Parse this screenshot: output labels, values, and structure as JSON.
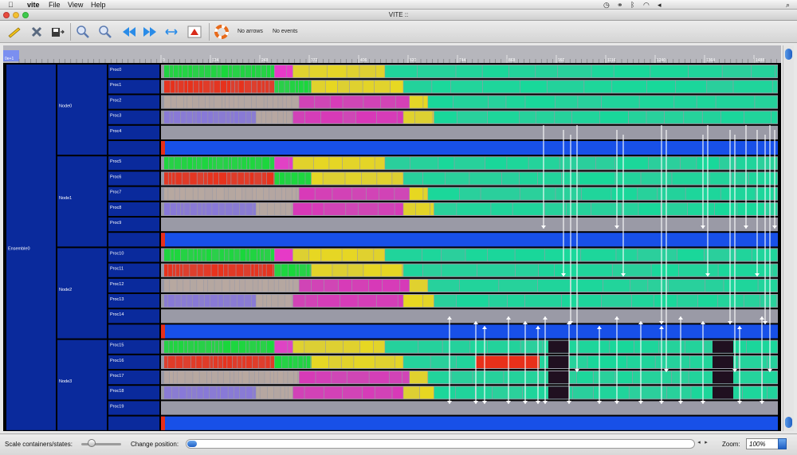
{
  "menubar": {
    "apple": "",
    "app_name": "vite",
    "items": [
      "File",
      "View",
      "Help"
    ]
  },
  "window": {
    "title": "VITE ::"
  },
  "toolbar": {
    "no_arrows_label": "No arrows",
    "no_events_label": "No events"
  },
  "ruler": {
    "start_label": "0e+1",
    "ticks": [
      "0",
      "124",
      "248",
      "372",
      "496",
      "620",
      "744",
      "868",
      "992",
      "1116",
      "1240",
      "1364",
      "1488",
      "1613",
      "1737",
      "1861"
    ]
  },
  "containers": {
    "root": "Ensemble0",
    "nodes": [
      {
        "name": "Node0",
        "procs": [
          "Proc0",
          "Proc1",
          "Proc2",
          "Proc3",
          "Proc4"
        ]
      },
      {
        "name": "Node1",
        "procs": [
          "Proc5",
          "Proc6",
          "Proc7",
          "Proc8",
          "Proc9"
        ]
      },
      {
        "name": "Node2",
        "procs": [
          "Proc10",
          "Proc11",
          "Proc12",
          "Proc13",
          "Proc14"
        ]
      },
      {
        "name": "Node3",
        "procs": [
          "Proc15",
          "Proc16",
          "Proc17",
          "Proc18",
          "Proc19"
        ]
      }
    ]
  },
  "bottombar": {
    "scale_label": "Scale containers/states:",
    "position_label": "Change position:",
    "zoom_label": "Zoom:",
    "zoom_value": "100%"
  },
  "colors": {
    "container": "#0a2a9c",
    "green": "#18d83a",
    "red": "#e8301a",
    "tan": "#b8a8a0",
    "purple": "#8878d8",
    "magenta": "#d838b8",
    "yellow": "#e8d820",
    "teal": "#18d89a",
    "dark": "#201020",
    "blue_bar": "#1850e8",
    "idle": "#9a9aa6"
  }
}
